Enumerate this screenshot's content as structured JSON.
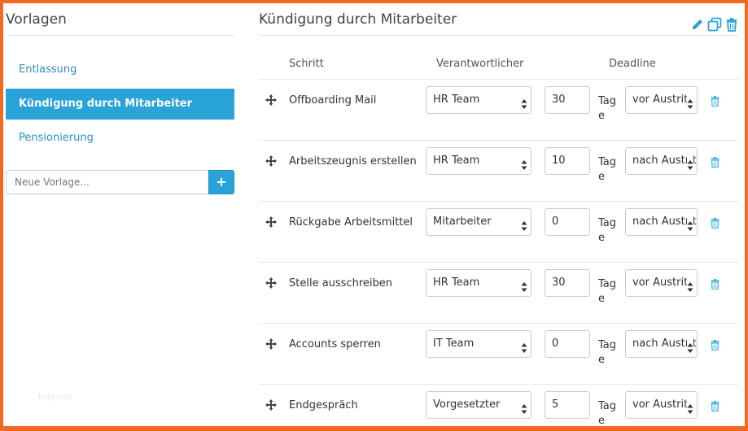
{
  "sidebar": {
    "title": "Vorlagen",
    "items": [
      {
        "label": "Entlassung",
        "active": false
      },
      {
        "label": "Kündigung durch Mitarbeiter",
        "active": true
      },
      {
        "label": "Pensionierung",
        "active": false
      }
    ],
    "new_template": {
      "placeholder": "Neue Vorlage...",
      "add_label": "+"
    },
    "watermark": "bing.com"
  },
  "main": {
    "title": "Kündigung durch Mitarbeiter",
    "actions": [
      "pencil-icon",
      "copy-icon",
      "trash-icon"
    ],
    "columns": {
      "step": "Schritt",
      "responsible": "Verantwortlicher",
      "deadline": "Deadline"
    },
    "rows": [
      {
        "step": "Offboarding Mail",
        "responsible": "HR Team",
        "days": "30",
        "unit": "Tage",
        "when": "vor Austritt"
      },
      {
        "step": "Arbeitszeugnis erstellen",
        "responsible": "HR Team",
        "days": "10",
        "unit": "Tage",
        "when": "nach Austritt"
      },
      {
        "step": "Rückgabe Arbeitsmittel",
        "responsible": "Mitarbeiter",
        "days": "0",
        "unit": "Tage",
        "when": "nach Austritt"
      },
      {
        "step": "Stelle ausschreiben",
        "responsible": "HR Team",
        "days": "30",
        "unit": "Tage",
        "when": "vor Austritt"
      },
      {
        "step": "Accounts sperren",
        "responsible": "IT Team",
        "days": "0",
        "unit": "Tage",
        "when": "nach Austritt"
      },
      {
        "step": "Endgespräch",
        "responsible": "Vorgesetzter",
        "days": "5",
        "unit": "Tage",
        "when": "vor Austritt"
      }
    ]
  },
  "colors": {
    "accent": "#2aa3d8",
    "link": "#2a8fbd",
    "frame": "#f26a21"
  }
}
